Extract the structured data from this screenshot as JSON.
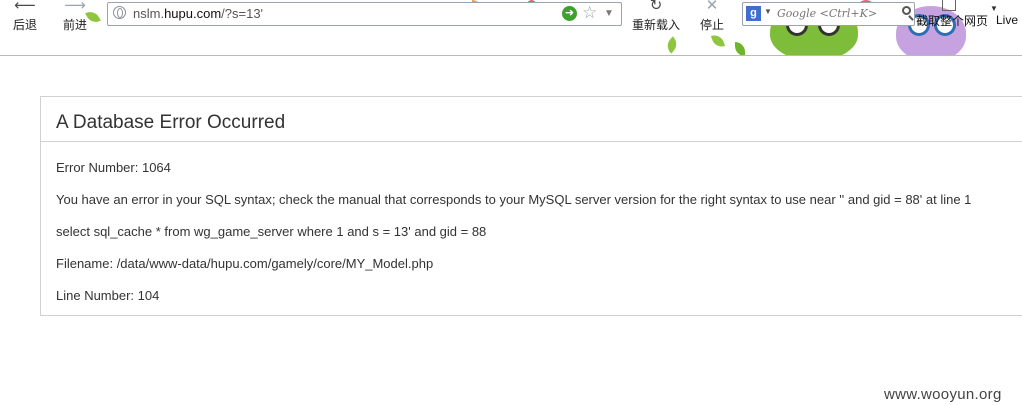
{
  "toolbar": {
    "back_label": "后退",
    "forward_label": "前进",
    "reload_label": "重新载入",
    "stop_label": "停止",
    "screenshot_label": "截取整个网页",
    "live_label": "Live"
  },
  "address_bar": {
    "url_prefix": "nslm.",
    "url_domain": "hupu.com",
    "url_path": "/?s=13'"
  },
  "search": {
    "engine_letter": "g",
    "placeholder": "Google <Ctrl+K>"
  },
  "error": {
    "title": "A Database Error Occurred",
    "error_number": "Error Number: 1064",
    "message": "You have an error in your SQL syntax; check the manual that corresponds to your MySQL server version for the right syntax to use near '' and gid = 88' at line 1",
    "query": "select sql_cache * from wg_game_server where 1 and s = 13' and gid = 88",
    "filename": "Filename: /data/www-data/hupu.com/gamely/core/MY_Model.php",
    "line_number": "Line Number: 104"
  },
  "watermark": "www.wooyun.org",
  "colors": {
    "accent_green": "#3aa32a",
    "search_engine_blue": "#3f6ecd",
    "panel_border": "#d0d0d0"
  },
  "icons": [
    "back-arrow-icon",
    "forward-arrow-icon",
    "globe-icon",
    "go-icon",
    "bookmark-star-icon",
    "reload-icon",
    "stop-icon",
    "search-icon",
    "screenshot-icon"
  ]
}
